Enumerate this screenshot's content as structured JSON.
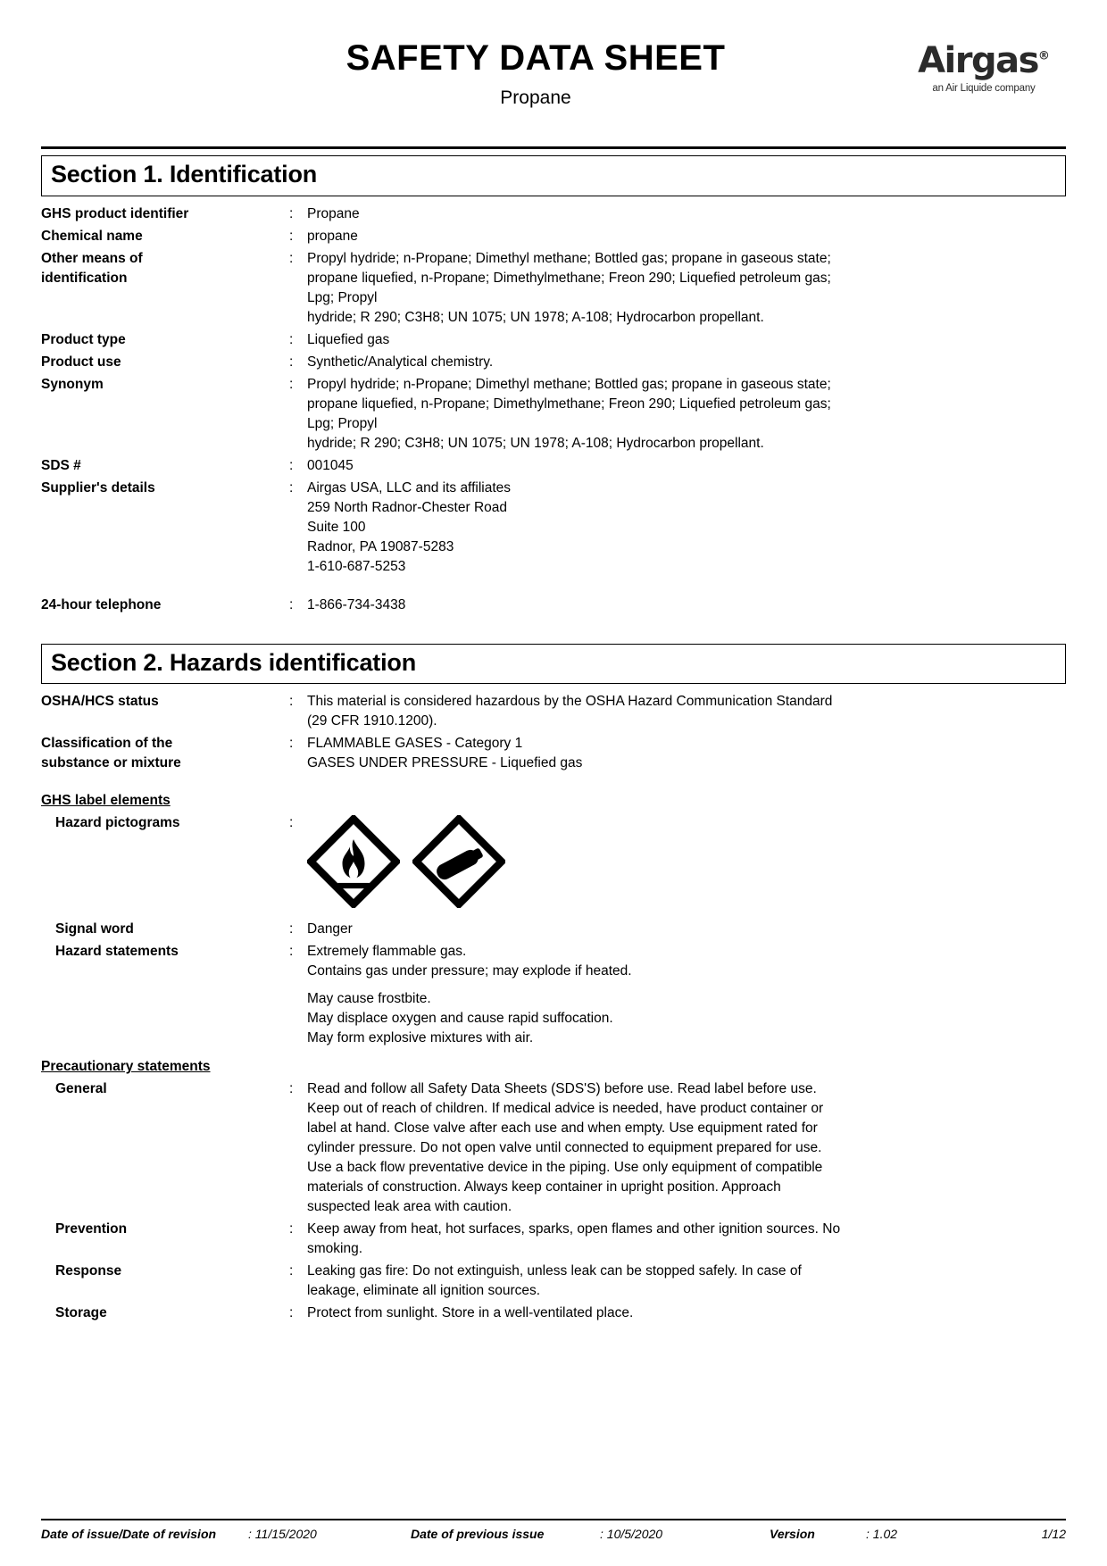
{
  "header": {
    "title": "SAFETY DATA SHEET",
    "subtitle": "Propane",
    "brand_name": "Airgas",
    "brand_registered": "®",
    "brand_tagline": "an Air Liquide company"
  },
  "section1": {
    "banner": "Section 1. Identification",
    "colon": ":",
    "rows": [
      {
        "label": "GHS product identifier",
        "value": "Propane"
      },
      {
        "label": "Chemical name",
        "value": "propane"
      },
      {
        "label": "Other means of\nidentification",
        "lines": [
          "Propyl hydride; n-Propane; Dimethyl methane; Bottled gas; propane in gaseous state;",
          "propane liquefied, n-Propane; Dimethylmethane; Freon 290; Liquefied petroleum gas;",
          "Lpg; Propyl",
          "hydride; R 290; C3H8; UN 1075; UN 1978; A-108; Hydrocarbon propellant."
        ]
      },
      {
        "label": "Product type",
        "value": "Liquefied gas"
      },
      {
        "label": "Product use",
        "value": "Synthetic/Analytical chemistry."
      },
      {
        "label": "Synonym",
        "lines": [
          "Propyl hydride; n-Propane; Dimethyl methane; Bottled gas; propane in gaseous state;",
          "propane liquefied, n-Propane; Dimethylmethane; Freon 290; Liquefied petroleum gas;",
          "Lpg; Propyl",
          "hydride; R 290; C3H8; UN 1075; UN 1978; A-108; Hydrocarbon propellant."
        ]
      },
      {
        "label": "SDS #",
        "value": "001045"
      },
      {
        "label": "Supplier's details",
        "lines": [
          "Airgas USA, LLC and its affiliates",
          "259 North Radnor-Chester Road",
          "Suite 100",
          "Radnor, PA 19087-5283",
          "1-610-687-5253"
        ]
      },
      {
        "label": "24-hour telephone",
        "value": "1-866-734-3438"
      }
    ]
  },
  "section2": {
    "banner": "Section 2. Hazards identification",
    "colon": ":",
    "osha_label": "OSHA/HCS status",
    "osha_lines": [
      "This material is considered hazardous by the OSHA Hazard Communication Standard",
      "(29 CFR 1910.1200)."
    ],
    "classification_label": "Classification of the\nsubstance or mixture",
    "classification_lines": [
      "FLAMMABLE GASES - Category 1",
      "GASES UNDER PRESSURE - Liquefied gas"
    ],
    "ghs_label_elements_heading": "GHS label elements",
    "pictograms_label": "Hazard pictograms",
    "pictograms": [
      "flame-pictogram",
      "gas-cylinder-pictogram"
    ],
    "signal_word_label": "Signal word",
    "signal_word_value": "Danger",
    "hazard_statements_label": "Hazard statements",
    "hazard_statements_group1": [
      "Extremely flammable gas.",
      "Contains gas under pressure; may explode if heated."
    ],
    "hazard_statements_group2": [
      "May cause frostbite.",
      "May displace oxygen and cause rapid suffocation.",
      "May form explosive mixtures with air."
    ],
    "precautionary_heading": "Precautionary statements",
    "general_label": "General",
    "general_lines": [
      "Read and follow all Safety Data Sheets (SDS'S) before use.  Read label before use.",
      "Keep out of reach of children.  If medical advice is needed, have product container or",
      "label at hand.  Close valve after each use and when empty.  Use equipment rated for",
      "cylinder pressure.  Do not open valve until connected to equipment prepared for use.",
      "Use a back flow preventative device in the piping.  Use only equipment of compatible",
      "materials of construction.  Always keep container in upright position.  Approach",
      "suspected leak area with caution."
    ],
    "prevention_label": "Prevention",
    "prevention_lines": [
      "Keep away from heat, hot surfaces, sparks, open flames and other ignition sources. No",
      "smoking."
    ],
    "response_label": "Response",
    "response_lines": [
      "Leaking gas fire: Do not extinguish, unless leak can be stopped safely.  In case of",
      "leakage, eliminate all ignition sources."
    ],
    "storage_label": "Storage",
    "storage_lines": [
      "Protect from sunlight. Store in a well-ventilated place."
    ]
  },
  "footer": {
    "issue_label": "Date of issue/Date of revision",
    "issue_value": ": 11/15/2020",
    "previous_label": "Date of previous issue",
    "previous_value": ": 10/5/2020",
    "version_label": "Version",
    "version_value": ": 1.02",
    "page_value": "1/12"
  }
}
